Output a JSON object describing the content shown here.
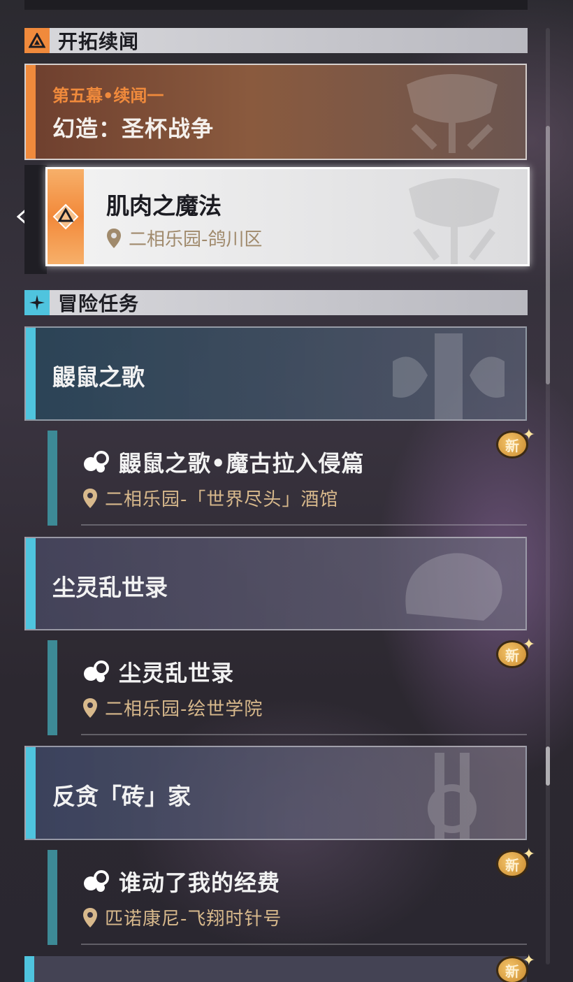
{
  "sections": {
    "trailblaze": {
      "title": "开拓续闻"
    },
    "adventure": {
      "title": "冒险任务"
    }
  },
  "trailblaze_main": {
    "chapter": "第五幕•续闻一",
    "title": "幻造：圣杯战争"
  },
  "trailblaze_sub": {
    "title": "肌肉之魔法",
    "location": "二相乐园-鸽川区"
  },
  "adventure_groups": [
    {
      "title": "鼹鼠之歌",
      "quest": {
        "title": "鼹鼠之歌•魔古拉入侵篇",
        "location": "二相乐园-「世界尽头」酒馆",
        "badge": "新"
      }
    },
    {
      "title": "尘灵乱世录",
      "quest": {
        "title": "尘灵乱世录",
        "location": "二相乐园-绘世学院",
        "badge": "新"
      }
    },
    {
      "title": "反贪「砖」家",
      "quest": {
        "title": "谁动了我的经费",
        "location": "匹诺康尼-飞翔时针号",
        "badge": "新"
      }
    }
  ],
  "partial_badge": "新",
  "colors": {
    "trailblaze_accent": "#f08a3c",
    "adventure_accent": "#4fc4de",
    "location_text": "#d8b98c"
  }
}
